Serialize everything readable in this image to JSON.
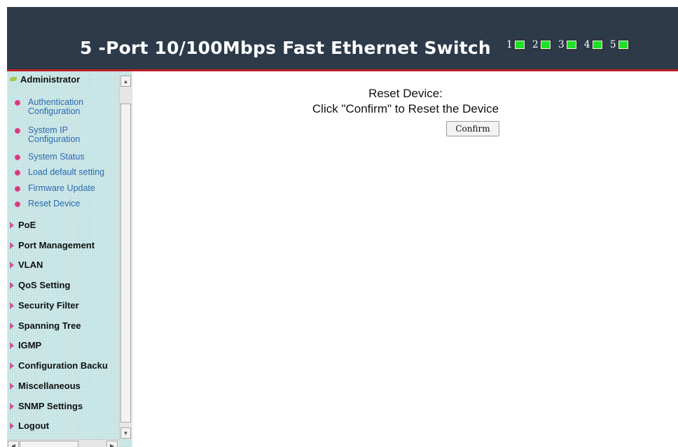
{
  "header": {
    "title": "5 -Port 10/100Mbps Fast Ethernet Switch",
    "ports": [
      {
        "num": "1",
        "status": "link-up"
      },
      {
        "num": "2",
        "status": "link-up"
      },
      {
        "num": "3",
        "status": "link-up"
      },
      {
        "num": "4",
        "status": "link-up"
      },
      {
        "num": "5",
        "status": "link-up"
      }
    ],
    "led_color": "#21e02a"
  },
  "sidebar": {
    "expanded": {
      "label": "Administrator",
      "items": [
        {
          "label": "Authentication Configuration"
        },
        {
          "label": "System IP Configuration"
        },
        {
          "label": "System Status"
        },
        {
          "label": "Load default setting"
        },
        {
          "label": "Firmware Update"
        },
        {
          "label": "Reset Device"
        }
      ]
    },
    "categories": [
      {
        "label": "PoE"
      },
      {
        "label": "Port Management"
      },
      {
        "label": "VLAN"
      },
      {
        "label": "QoS Setting"
      },
      {
        "label": "Security Filter"
      },
      {
        "label": "Spanning Tree"
      },
      {
        "label": "IGMP"
      },
      {
        "label": "Configuration Backu"
      },
      {
        "label": "Miscellaneous"
      },
      {
        "label": "SNMP Settings"
      },
      {
        "label": "Logout"
      }
    ]
  },
  "main": {
    "heading": "Reset Device:",
    "instruction": "Click \"Confirm\" to Reset the Device",
    "confirm_label": "Confirm"
  },
  "colors": {
    "header_bg": "#2c3a4a",
    "header_border": "#b91e24",
    "sidebar_bg": "#bfe0e0",
    "submenu_link": "#2c69b0"
  }
}
